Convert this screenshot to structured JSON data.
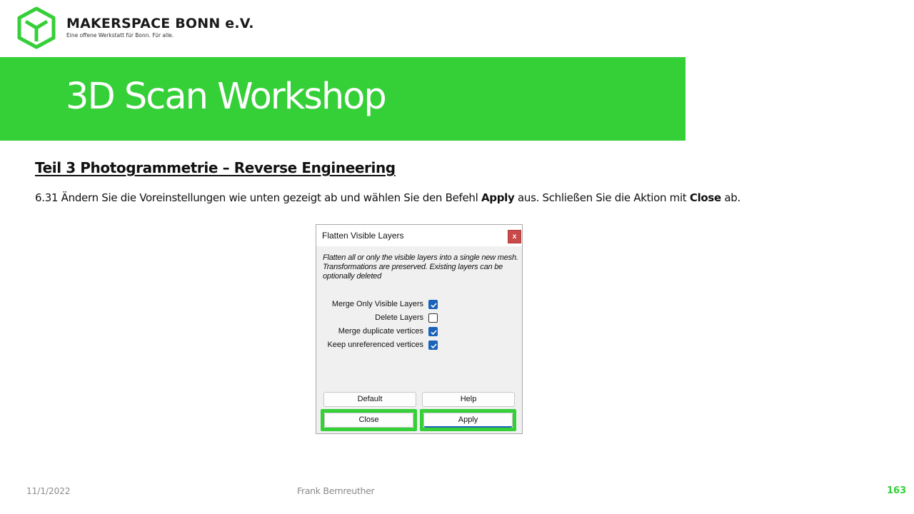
{
  "brand": {
    "name": "MAKERSPACE BONN e.V.",
    "tagline": "Eine offene Werkstatt für Bonn. Für alle.",
    "color": "#35cf38",
    "logo_icon": "hexagon-cube-icon"
  },
  "slide": {
    "title": "3D Scan Workshop",
    "heading": "Teil 3  Photogrammetrie  – Reverse Engineering",
    "instruction": {
      "part1": "6.31 Ändern Sie die Voreinstellungen wie unten gezeigt ab und wählen Sie den Befehl ",
      "bold1": "Apply",
      "part2": " aus. Schließen Sie die Aktion mit ",
      "bold2": "Close",
      "part3": " ab."
    }
  },
  "dialog": {
    "title": "Flatten Visible Layers",
    "close_glyph": "x",
    "description_line1": "Flatten all or only the visible layers into a single new mesh.",
    "description_line2": "Transformations are preserved. Existing layers can be optionally deleted",
    "options": [
      {
        "label": "Merge Only Visible Layers",
        "checked": true
      },
      {
        "label": "Delete Layers",
        "checked": false
      },
      {
        "label": "Merge duplicate vertices",
        "checked": true
      },
      {
        "label": "Keep unreferenced vertices",
        "checked": true
      }
    ],
    "buttons": {
      "default": "Default",
      "help": "Help",
      "close": "Close",
      "apply": "Apply"
    }
  },
  "footer": {
    "date": "11/1/2022",
    "author": "Frank Bernreuther",
    "page_number": "163"
  }
}
